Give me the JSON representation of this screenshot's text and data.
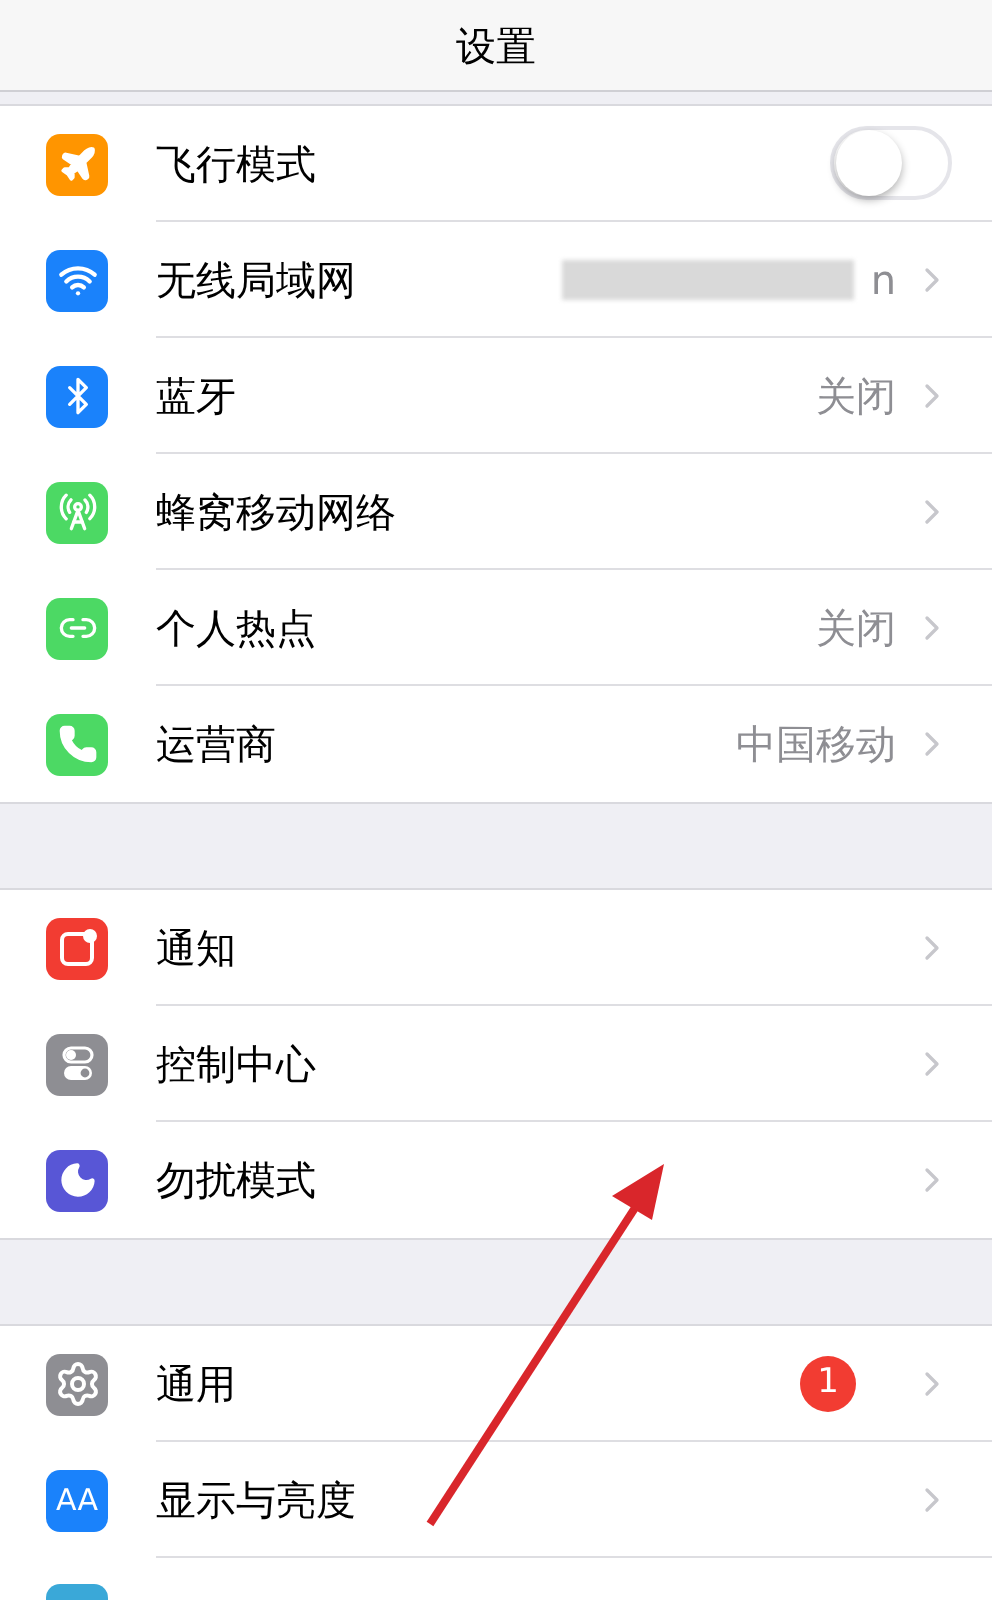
{
  "nav_bar": {
    "title": "设置"
  },
  "groups": [
    {
      "rows": [
        {
          "kind": "toggle",
          "color": "#ff9500",
          "label": "飞行模式",
          "on": false
        },
        {
          "kind": "link",
          "color": "#1a82fb",
          "label": "无线局域网",
          "redacted": true,
          "value": "n"
        },
        {
          "kind": "link",
          "color": "#1a82fb",
          "label": "蓝牙",
          "value": "关闭"
        },
        {
          "kind": "link",
          "color": "#4cd964",
          "label": "蜂窝移动网络"
        },
        {
          "kind": "link",
          "color": "#4cd964",
          "label": "个人热点",
          "value": "关闭"
        },
        {
          "kind": "link",
          "color": "#4cd964",
          "label": "运营商",
          "value": "中国移动"
        }
      ]
    },
    {
      "rows": [
        {
          "kind": "link",
          "color": "#f23c32",
          "label": "通知"
        },
        {
          "kind": "link",
          "color": "#8e8e93",
          "label": "控制中心"
        },
        {
          "kind": "link",
          "color": "#5856d6",
          "label": "勿扰模式"
        }
      ]
    },
    {
      "rows": [
        {
          "kind": "link",
          "color": "#8e8e93",
          "label": "通用",
          "badge": "1"
        },
        {
          "kind": "link",
          "icon_text": "AA",
          "color": "#1a82fb",
          "label": "显示与亮度"
        },
        {
          "kind": "partial",
          "color": "#3aa8d8"
        }
      ]
    }
  ]
}
